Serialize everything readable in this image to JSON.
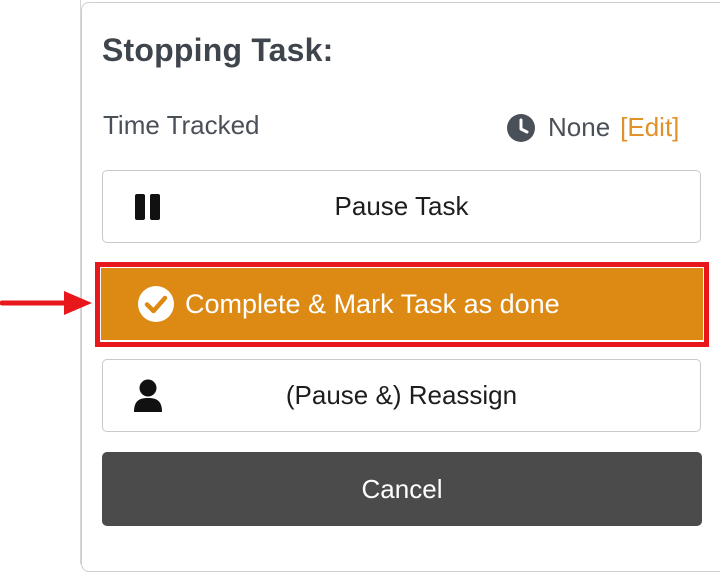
{
  "modal": {
    "title": "Stopping Task:",
    "time_tracked": {
      "label": "Time Tracked",
      "value": "None",
      "edit_label": "[Edit]",
      "icon": "clock-icon"
    },
    "buttons": {
      "pause": {
        "label": "Pause Task",
        "icon": "pause-icon"
      },
      "complete": {
        "label": "Complete & Mark Task as done",
        "icon": "check-circle-icon"
      },
      "reassign": {
        "label": "(Pause &) Reassign",
        "icon": "user-icon"
      },
      "cancel": {
        "label": "Cancel"
      }
    }
  },
  "annotation": {
    "highlight_color": "#e8171b",
    "arrow_color": "#e8171b"
  },
  "colors": {
    "accent": "#dd8a15",
    "edit_link": "#e0922a",
    "cancel_bg": "#4b4b4b",
    "title_text": "#3f454c"
  }
}
